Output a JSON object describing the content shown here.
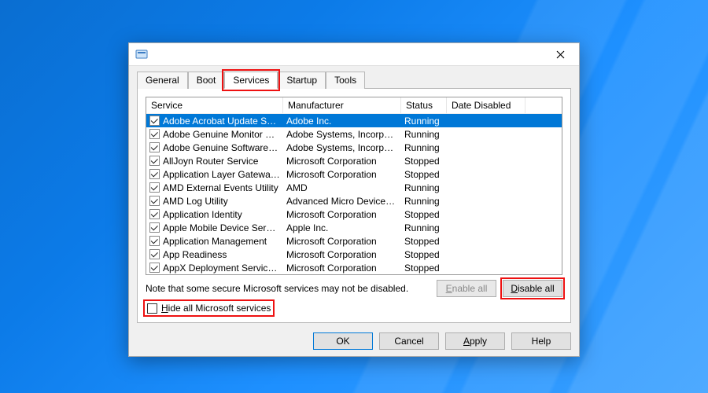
{
  "tabs": [
    "General",
    "Boot",
    "Services",
    "Startup",
    "Tools"
  ],
  "active_tab": "Services",
  "columns": {
    "service": "Service",
    "manufacturer": "Manufacturer",
    "status": "Status",
    "date_disabled": "Date Disabled"
  },
  "services": [
    {
      "checked": true,
      "name": "Adobe Acrobat Update Service",
      "manufacturer": "Adobe Inc.",
      "status": "Running",
      "selected": true
    },
    {
      "checked": true,
      "name": "Adobe Genuine Monitor Service",
      "manufacturer": "Adobe Systems, Incorpora...",
      "status": "Running"
    },
    {
      "checked": true,
      "name": "Adobe Genuine Software Integri...",
      "manufacturer": "Adobe Systems, Incorpora...",
      "status": "Running"
    },
    {
      "checked": true,
      "name": "AllJoyn Router Service",
      "manufacturer": "Microsoft Corporation",
      "status": "Stopped"
    },
    {
      "checked": true,
      "name": "Application Layer Gateway Service",
      "manufacturer": "Microsoft Corporation",
      "status": "Stopped"
    },
    {
      "checked": true,
      "name": "AMD External Events Utility",
      "manufacturer": "AMD",
      "status": "Running"
    },
    {
      "checked": true,
      "name": "AMD Log Utility",
      "manufacturer": "Advanced Micro Devices, I...",
      "status": "Running"
    },
    {
      "checked": true,
      "name": "Application Identity",
      "manufacturer": "Microsoft Corporation",
      "status": "Stopped"
    },
    {
      "checked": true,
      "name": "Apple Mobile Device Service",
      "manufacturer": "Apple Inc.",
      "status": "Running"
    },
    {
      "checked": true,
      "name": "Application Management",
      "manufacturer": "Microsoft Corporation",
      "status": "Stopped"
    },
    {
      "checked": true,
      "name": "App Readiness",
      "manufacturer": "Microsoft Corporation",
      "status": "Stopped"
    },
    {
      "checked": true,
      "name": "AppX Deployment Service (AppX...",
      "manufacturer": "Microsoft Corporation",
      "status": "Stopped"
    }
  ],
  "note_text": "Note that some secure Microsoft services may not be disabled.",
  "buttons": {
    "enable_all": "Enable all",
    "disable_all": "Disable all",
    "ok": "OK",
    "cancel": "Cancel",
    "apply": "Apply",
    "help": "Help"
  },
  "hide_checkbox_label_pre": "H",
  "hide_checkbox_label_rest": "ide all Microsoft services"
}
